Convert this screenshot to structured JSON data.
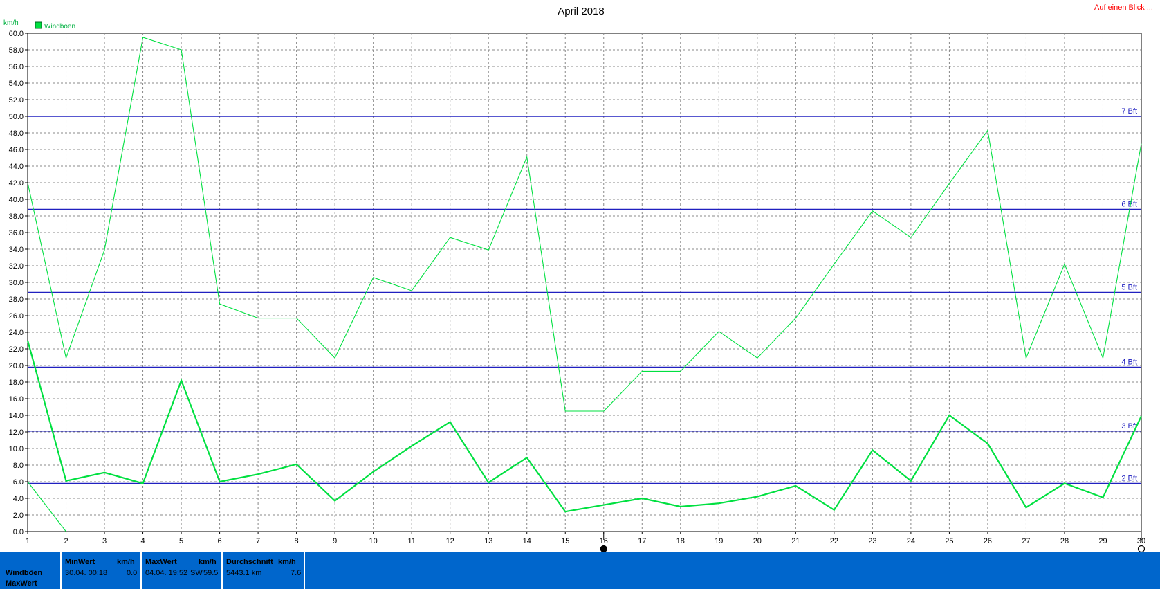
{
  "title": "April 2018",
  "link_label": "Auf einen Blick ...",
  "ylabel": "km/h",
  "legend": {
    "label": "Windböen",
    "color": "#00e040"
  },
  "chart_data": {
    "type": "line",
    "title": "April 2018",
    "ylabel": "km/h",
    "xlabel": "",
    "ylim": [
      0,
      60
    ],
    "ytick_step": 2,
    "x": [
      1,
      2,
      3,
      4,
      5,
      6,
      7,
      8,
      9,
      10,
      11,
      12,
      13,
      14,
      15,
      16,
      17,
      18,
      19,
      20,
      21,
      22,
      23,
      24,
      25,
      26,
      27,
      28,
      29,
      30
    ],
    "grid": true,
    "legend_position": "top-left",
    "series": [
      {
        "name": "Windböen",
        "role": "max",
        "color": "#00e040",
        "values": [
          42.0,
          20.9,
          33.9,
          59.5,
          58.0,
          27.4,
          25.7,
          25.7,
          20.9,
          30.6,
          29.0,
          35.4,
          33.9,
          45.1,
          14.5,
          14.5,
          19.3,
          19.3,
          24.1,
          20.9,
          25.7,
          32.2,
          38.6,
          35.4,
          41.9,
          48.3,
          20.9,
          32.2,
          20.9,
          46.7
        ]
      },
      {
        "name": "Windböen",
        "role": "mean",
        "color": "#00e040",
        "values": [
          23.0,
          6.1,
          7.1,
          5.8,
          18.2,
          6.0,
          6.9,
          8.1,
          3.7,
          7.2,
          10.3,
          13.2,
          5.9,
          8.9,
          2.4,
          3.2,
          4.0,
          3.0,
          3.4,
          4.2,
          5.5,
          2.6,
          9.8,
          6.1,
          14.0,
          10.6,
          2.9,
          5.8,
          4.1,
          13.9
        ]
      },
      {
        "name": "Windböen",
        "role": "min",
        "color": "#00e040",
        "values": [
          6.0,
          0.0
        ]
      }
    ],
    "reference_lines": [
      {
        "label": "2 Bft",
        "value": 5.8
      },
      {
        "label": "3 Bft",
        "value": 12.1
      },
      {
        "label": "4 Bft",
        "value": 19.8
      },
      {
        "label": "5 Bft",
        "value": 28.8
      },
      {
        "label": "6 Bft",
        "value": 38.8
      },
      {
        "label": "7 Bft",
        "value": 50.0
      }
    ],
    "markers": [
      {
        "x": 16,
        "style": "filled"
      },
      {
        "x": 30,
        "style": "open"
      }
    ]
  },
  "footer": {
    "row_label_1": "Windböen",
    "row_label_2": "MaxWert",
    "min": {
      "header": "MinWert",
      "unit": "km/h",
      "datetime": "30.04.  00:18",
      "value": "0.0"
    },
    "max": {
      "header": "MaxWert",
      "unit": "km/h",
      "datetime": "04.04.  19:52",
      "dir": "SW",
      "value": "59.5"
    },
    "avg": {
      "header": "Durchschnitt",
      "unit": "km/h",
      "dist": "5443.1 km",
      "value": "7.6"
    }
  }
}
